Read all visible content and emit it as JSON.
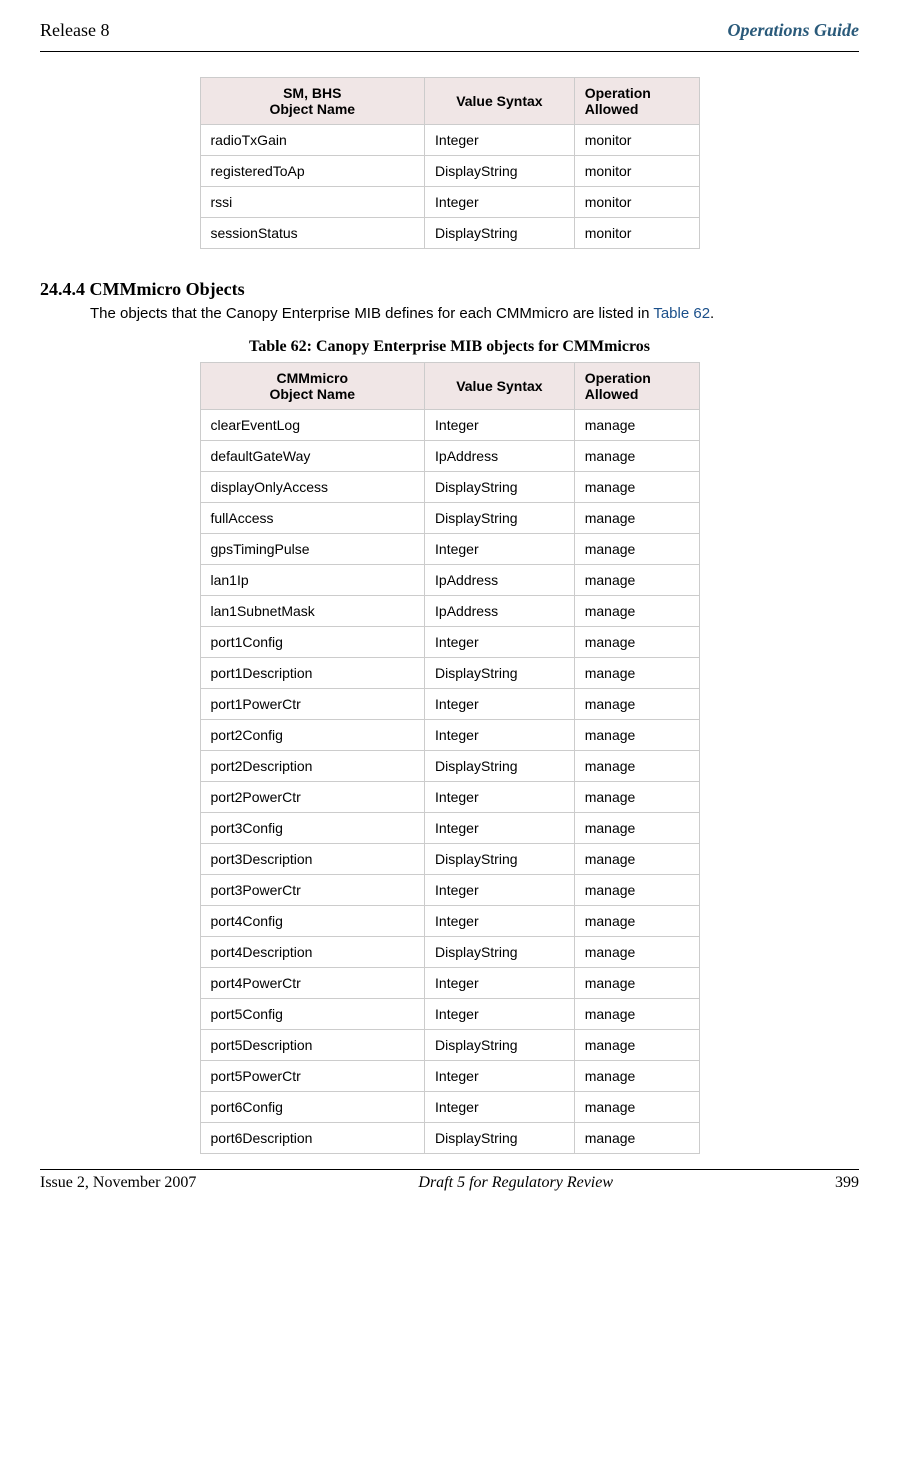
{
  "header": {
    "left": "Release 8",
    "right": "Operations Guide"
  },
  "table1": {
    "headers": [
      "SM, BHS\nObject Name",
      "Value Syntax",
      "Operation Allowed"
    ],
    "rows": [
      [
        "radioTxGain",
        "Integer",
        "monitor"
      ],
      [
        "registeredToAp",
        "DisplayString",
        "monitor"
      ],
      [
        "rssi",
        "Integer",
        "monitor"
      ],
      [
        "sessionStatus",
        "DisplayString",
        "monitor"
      ]
    ]
  },
  "section": {
    "num_title": "24.4.4    CMMmicro Objects",
    "body_prefix": "The objects that the Canopy Enterprise MIB defines for each CMMmicro are listed in ",
    "link": "Table 62",
    "body_suffix": "."
  },
  "table2_caption": "Table 62: Canopy Enterprise MIB objects for CMMmicros",
  "table2": {
    "headers": [
      "CMMmicro\nObject Name",
      "Value Syntax",
      "Operation Allowed"
    ],
    "rows": [
      [
        "clearEventLog",
        "Integer",
        "manage"
      ],
      [
        "defaultGateWay",
        "IpAddress",
        "manage"
      ],
      [
        "displayOnlyAccess",
        "DisplayString",
        "manage"
      ],
      [
        "fullAccess",
        "DisplayString",
        "manage"
      ],
      [
        "gpsTimingPulse",
        "Integer",
        "manage"
      ],
      [
        "lan1Ip",
        "IpAddress",
        "manage"
      ],
      [
        "lan1SubnetMask",
        "IpAddress",
        "manage"
      ],
      [
        "port1Config",
        "Integer",
        "manage"
      ],
      [
        "port1Description",
        "DisplayString",
        "manage"
      ],
      [
        "port1PowerCtr",
        "Integer",
        "manage"
      ],
      [
        "port2Config",
        "Integer",
        "manage"
      ],
      [
        "port2Description",
        "DisplayString",
        "manage"
      ],
      [
        "port2PowerCtr",
        "Integer",
        "manage"
      ],
      [
        "port3Config",
        "Integer",
        "manage"
      ],
      [
        "port3Description",
        "DisplayString",
        "manage"
      ],
      [
        "port3PowerCtr",
        "Integer",
        "manage"
      ],
      [
        "port4Config",
        "Integer",
        "manage"
      ],
      [
        "port4Description",
        "DisplayString",
        "manage"
      ],
      [
        "port4PowerCtr",
        "Integer",
        "manage"
      ],
      [
        "port5Config",
        "Integer",
        "manage"
      ],
      [
        "port5Description",
        "DisplayString",
        "manage"
      ],
      [
        "port5PowerCtr",
        "Integer",
        "manage"
      ],
      [
        "port6Config",
        "Integer",
        "manage"
      ],
      [
        "port6Description",
        "DisplayString",
        "manage"
      ]
    ]
  },
  "footer": {
    "left": "Issue 2, November 2007",
    "center": "Draft 5 for Regulatory Review",
    "right": "399"
  }
}
